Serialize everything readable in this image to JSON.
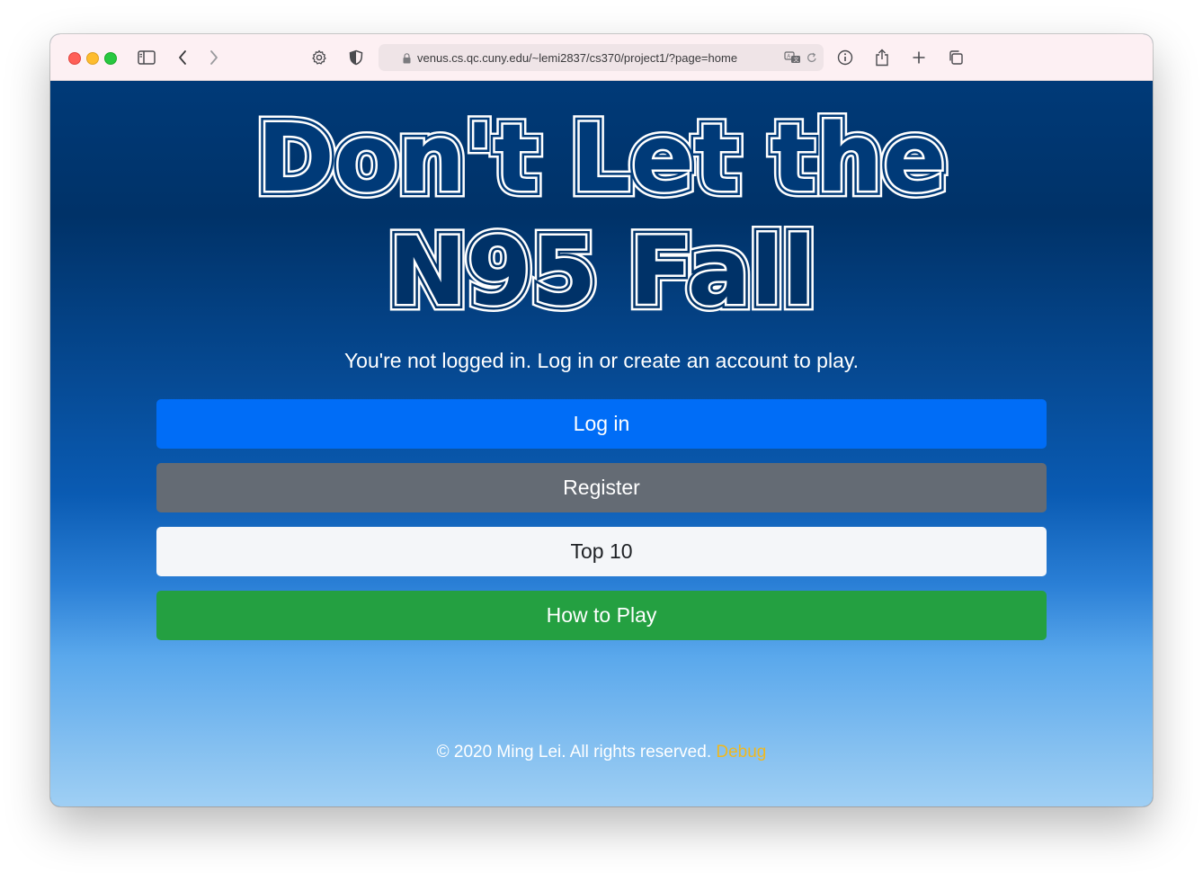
{
  "browser": {
    "url": "venus.cs.qc.cuny.edu/~lemi2837/cs370/project1/?page=home",
    "icons": [
      "sidebar-icon",
      "back-icon",
      "forward-icon",
      "settings-icon",
      "shield-icon",
      "lock-icon",
      "translate-icon",
      "reload-icon",
      "info-icon",
      "share-icon",
      "new-tab-icon",
      "tabs-overview-icon"
    ]
  },
  "page": {
    "title_line1": "Don't Let the",
    "title_line2": "N95 Fall",
    "status": "You're not logged in. Log in or create an account to play.",
    "buttons": {
      "login": "Log in",
      "register": "Register",
      "top10": "Top 10",
      "how_to_play": "How to Play"
    },
    "footer": {
      "copyright": "© 2020 Ming Lei. All rights reserved.",
      "debug": "Debug"
    }
  },
  "colors": {
    "login": "#006df7",
    "register": "#646b74",
    "top10": "#f4f6f9",
    "how_to_play": "#24a041",
    "debug_link": "#f0b81e"
  }
}
